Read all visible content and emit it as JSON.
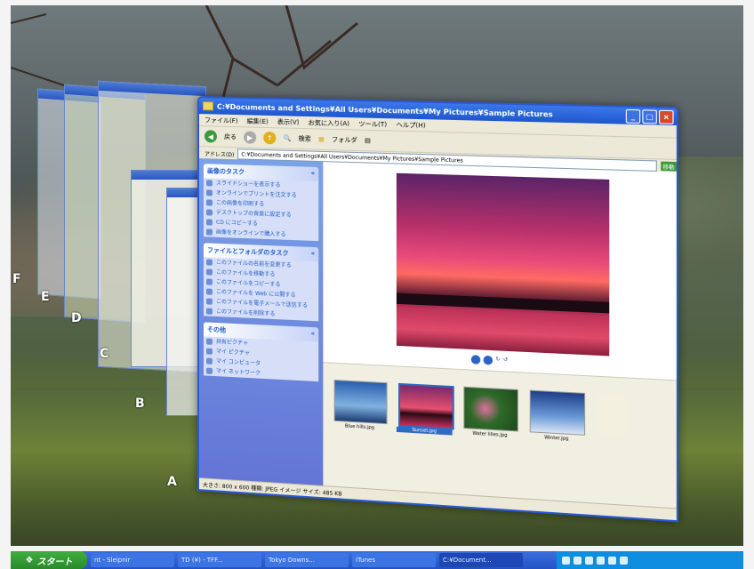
{
  "window": {
    "title": "C:¥Documents and Settings¥All Users¥Documents¥My Pictures¥Sample Pictures",
    "address": "C:¥Documents and Settings¥All Users¥Documents¥My Pictures¥Sample Pictures",
    "address_label": "アドレス(D)",
    "go_label": "移動",
    "status": "大きさ: 800 x 600 種類: JPEG イメージ サイズ: 485 KB"
  },
  "menu": [
    "ファイル(F)",
    "編集(E)",
    "表示(V)",
    "お気に入り(A)",
    "ツール(T)",
    "ヘルプ(H)"
  ],
  "toolbar": {
    "back": "戻る",
    "search": "検索",
    "folders": "フォルダ"
  },
  "panels": [
    {
      "title": "画像のタスク",
      "items": [
        "スライドショーを表示する",
        "オンラインでプリントを注文する",
        "この画像を印刷する",
        "デスクトップの背景に設定する",
        "CD にコピーする",
        "画像をオンラインで購入する"
      ]
    },
    {
      "title": "ファイルとフォルダのタスク",
      "items": [
        "このファイルの名前を変更する",
        "このファイルを移動する",
        "このファイルをコピーする",
        "このファイルを Web に公開する",
        "このファイルを電子メールで送信する",
        "このファイルを削除する"
      ]
    },
    {
      "title": "その他",
      "items": [
        "共有ピクチャ",
        "マイ ピクチャ",
        "マイ コンピュータ",
        "マイ ネットワーク"
      ]
    }
  ],
  "thumbnails": [
    "Blue hills.jpg",
    "Sunset.jpg",
    "Water lilies.jpg",
    "Winter.jpg"
  ],
  "layer_labels": [
    "F",
    "E",
    "D",
    "C",
    "B",
    "A"
  ],
  "taskbar": {
    "start": "スタート",
    "tasks": [
      "nt - Sleipnir",
      "TD (¥) - TFF...",
      "Tokyo Downs...",
      "iTunes",
      "C:¥Document..."
    ]
  }
}
